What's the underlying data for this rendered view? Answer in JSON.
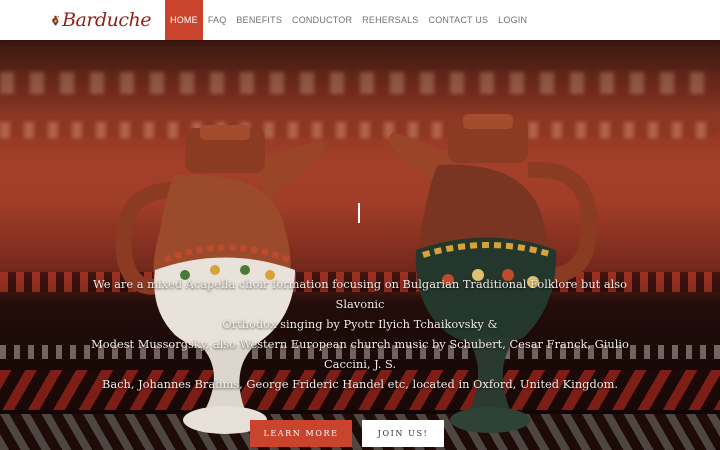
{
  "header": {
    "brand": {
      "text": "Barduche",
      "logo_icon": "jug-logo-icon"
    },
    "nav": [
      {
        "label": "HOME",
        "active": true
      },
      {
        "label": "FAQ",
        "active": false
      },
      {
        "label": "BENEFITS",
        "active": false
      },
      {
        "label": "CONDUCTOR",
        "active": false
      },
      {
        "label": "REHERSALS",
        "active": false
      },
      {
        "label": "CONTACT US",
        "active": false
      },
      {
        "label": "LOGIN",
        "active": false
      }
    ]
  },
  "hero": {
    "lines": [
      "We are a mixed Acapella choir formation focusing on Bulgarian Traditional Folklore but also Slavonic",
      "Orthodox singing by Pyotr Ilyich Tchaikovsky &",
      "Modest Mussorgsky, also Western European church music by Schubert, Cesar Franck, Giulio Caccini, J. S.",
      "Bach, Johannes Brahms, George Frideric Handel etc, located in Oxford, United Kingdom."
    ],
    "buttons": {
      "learn_more": "LEARN MORE",
      "join_us": "JOIN US!"
    }
  },
  "colors": {
    "accent": "#c9432d",
    "nav_text": "#707070",
    "brand": "#8e2418",
    "hero_text": "#f2ece6"
  }
}
